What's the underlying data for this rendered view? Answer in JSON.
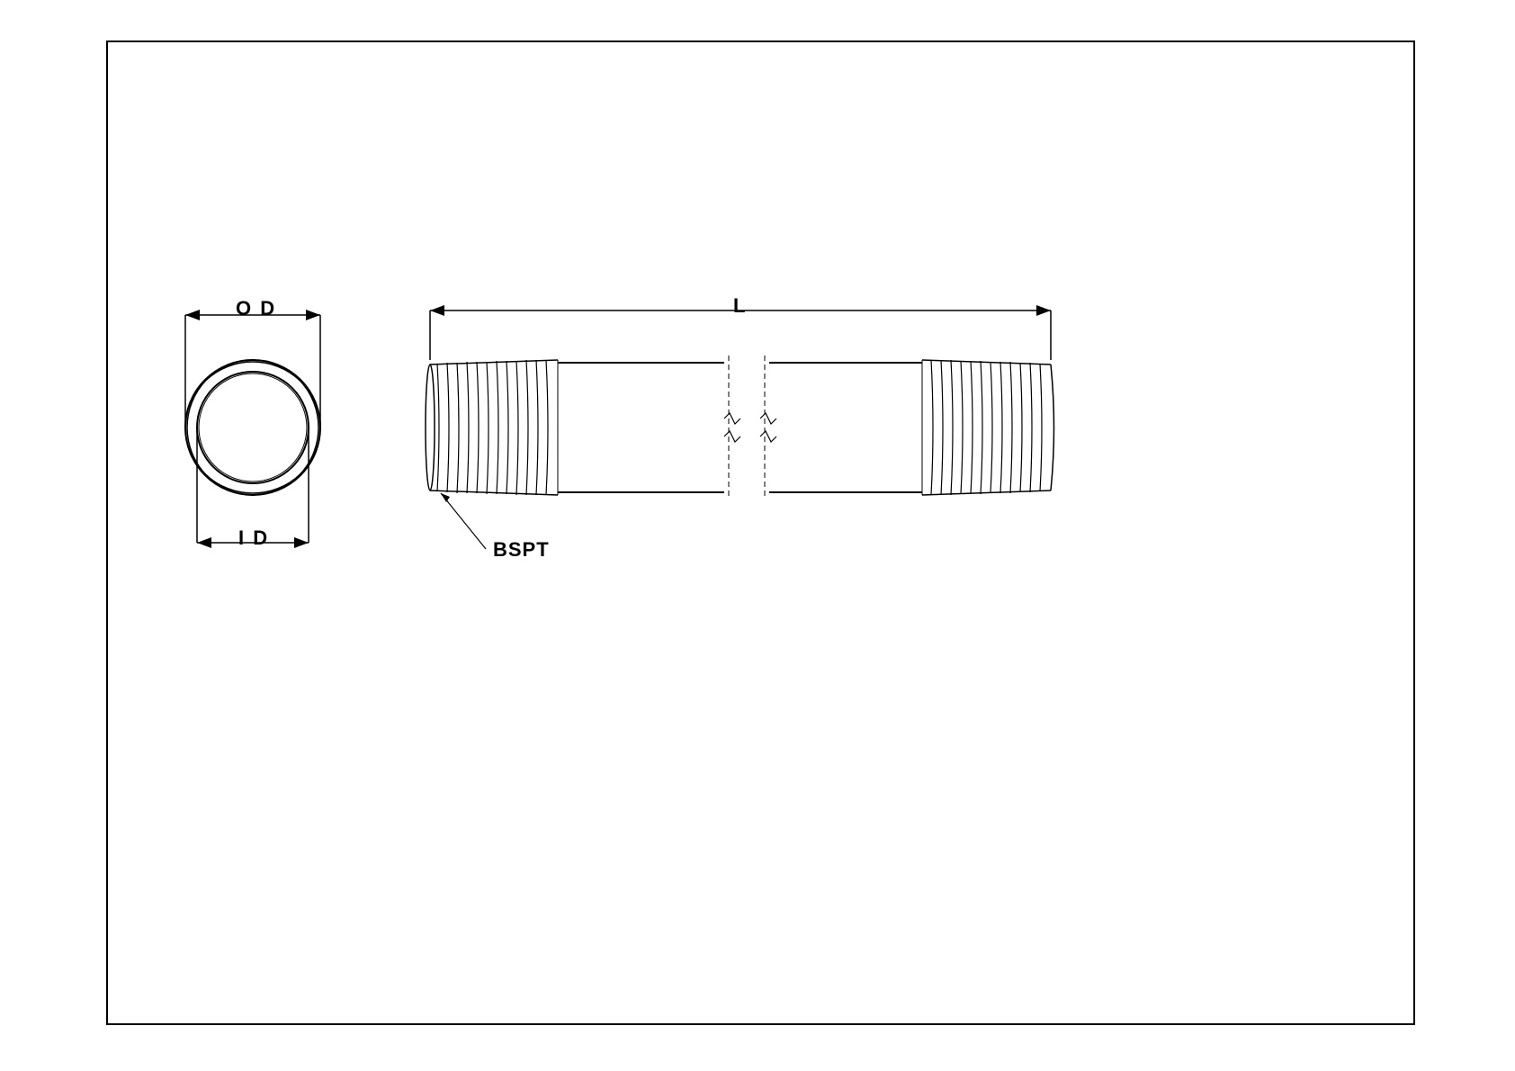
{
  "labels": {
    "od": "O D",
    "id": "I D",
    "length": "L",
    "thread": "BSPT"
  }
}
